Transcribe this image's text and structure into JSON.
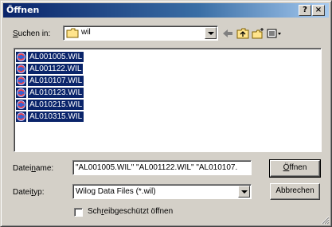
{
  "window": {
    "title": "Öffnen",
    "help_label": "?",
    "close_label": "×"
  },
  "lookin": {
    "label_pre": "",
    "label_u": "S",
    "label_post": "uchen in:",
    "value": "wil"
  },
  "toolbar": {
    "back": "back-arrow-icon",
    "up": "up-folder-icon",
    "new_folder": "new-folder-icon",
    "views": "view-menu-icon"
  },
  "files": [
    {
      "name": "AL001005.WIL"
    },
    {
      "name": "AL001122.WIL"
    },
    {
      "name": "AL010107.WIL"
    },
    {
      "name": "AL010123.WIL"
    },
    {
      "name": "AL010215.WIL"
    },
    {
      "name": "AL010315.WIL"
    }
  ],
  "filename": {
    "label_pre": "Datei",
    "label_u": "n",
    "label_post": "ame:",
    "value": "\"AL001005.WIL\" \"AL001122.WIL\" \"AL010107."
  },
  "filetype": {
    "label_pre": "Datei",
    "label_u": "t",
    "label_post": "yp:",
    "value": "Wilog Data Files (*.wil)"
  },
  "buttons": {
    "open_pre": "",
    "open_u": "Ö",
    "open_post": "ffnen",
    "cancel": "Abbrechen"
  },
  "readonly": {
    "label_pre": "Sch",
    "label_u": "r",
    "label_post": "eibgeschützt öffnen",
    "checked": false
  },
  "colors": {
    "selection": "#0a246a",
    "titlebar": "#0a246a",
    "face": "#d4d0c8"
  }
}
